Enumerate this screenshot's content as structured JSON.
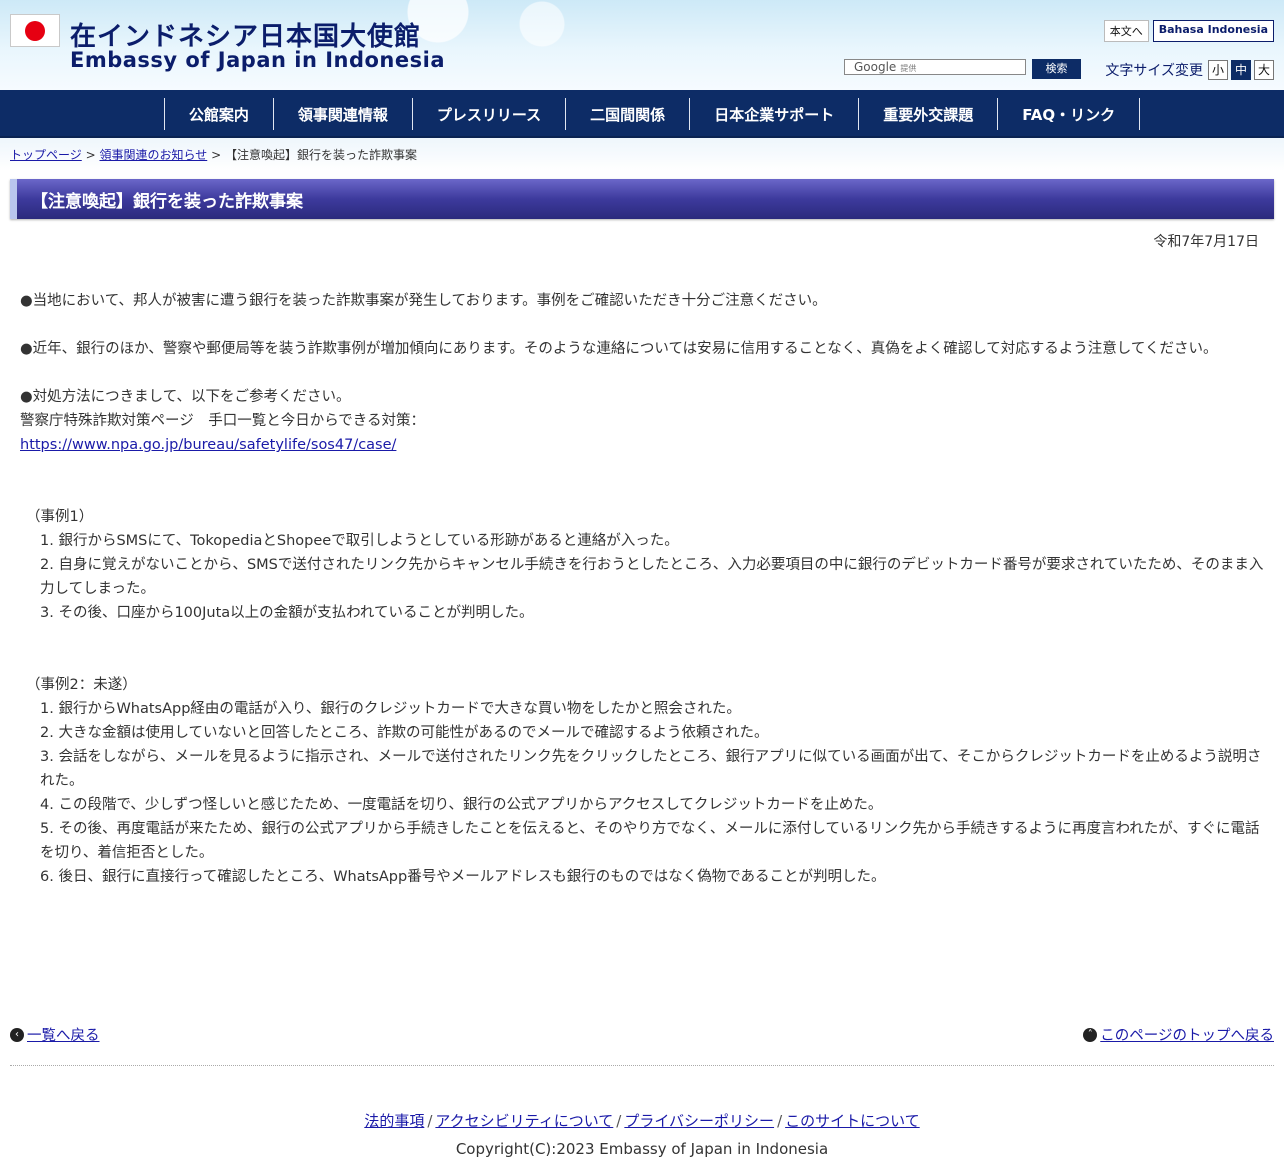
{
  "header": {
    "title_jp": "在インドネシア日本国大使館",
    "title_en": "Embassy of Japan in Indonesia",
    "lang_japanese": "本文へ",
    "lang_indonesian": "Bahasa Indonesia",
    "search_placeholder": "Google",
    "search_powered": "提供",
    "search_button": "検索",
    "fontsize_label": "文字サイズ変更",
    "fontsize_small": "小",
    "fontsize_medium": "中",
    "fontsize_large": "大"
  },
  "nav": {
    "items": [
      "公館案内",
      "領事関連情報",
      "プレスリリース",
      "二国間関係",
      "日本企業サポート",
      "重要外交課題",
      "FAQ・リンク"
    ]
  },
  "breadcrumb": {
    "home": "トップページ",
    "section": "領事関連のお知らせ",
    "current": "【注意喚起】銀行を装った詐欺事案",
    "sep": ">"
  },
  "page": {
    "title": "【注意喚起】銀行を装った詐欺事案",
    "date": "令和7年7月17日",
    "para1": "●当地において、邦人が被害に遭う銀行を装った詐欺事案が発生しております。事例をご確認いただき十分ご注意ください。",
    "para2": "●近年、銀行のほか、警察や郵便局等を装う詐欺事例が増加傾向にあります。そのような連絡については安易に信用することなく、真偽をよく確認して対応するよう注意してください。",
    "para3_line1": "●対処方法につきまして、以下をご参考ください。",
    "para3_line2": "警察庁特殊詐欺対策ページ　手口一覧と今日からできる対策：",
    "para3_link": "https://www.npa.go.jp/bureau/safetylife/sos47/case/",
    "case1_heading": "（事例1）",
    "case1_items": [
      "1. 銀行からSMSにて、TokopediaとShopeeで取引しようとしている形跡があると連絡が入った。",
      "2. 自身に覚えがないことから、SMSで送付されたリンク先からキャンセル手続きを行おうとしたところ、入力必要項目の中に銀行のデビットカード番号が要求されていたため、そのまま入力してしまった。",
      "3. その後、口座から100Juta以上の金額が支払われていることが判明した。"
    ],
    "case2_heading": "（事例2：未遂）",
    "case2_items": [
      "1. 銀行からWhatsApp経由の電話が入り、銀行のクレジットカードで大きな買い物をしたかと照会された。",
      "2. 大きな金額は使用していないと回答したところ、詐欺の可能性があるのでメールで確認するよう依頼された。",
      "3. 会話をしながら、メールを見るように指示され、メールで送付されたリンク先をクリックしたところ、銀行アプリに似ている画面が出て、そこからクレジットカードを止めるよう説明された。",
      "4. この段階で、少しずつ怪しいと感じたため、一度電話を切り、銀行の公式アプリからアクセスしてクレジットカードを止めた。",
      "5. その後、再度電話が来たため、銀行の公式アプリから手続きしたことを伝えると、そのやり方でなく、メールに添付しているリンク先から手続きするように再度言われたが、すぐに電話を切り、着信拒否とした。",
      "6. 後日、銀行に直接行って確認したところ、WhatsApp番号やメールアドレスも銀行のものではなく偽物であることが判明した。"
    ]
  },
  "links": {
    "back_to_list": "一覧へ戻る",
    "to_top": "このページのトップへ戻る"
  },
  "footer": {
    "legal": "法的事項",
    "accessibility": "アクセシビリティについて",
    "privacy": "プライバシーポリシー",
    "about": "このサイトについて",
    "sep": "/",
    "copyright": "Copyright(C):2023 Embassy of Japan in Indonesia"
  },
  "colors": {
    "nav_bg": "#0d2c66",
    "title_bar": "#3d3a9d",
    "link": "#1a1aa8",
    "flag_red": "#e60012"
  }
}
